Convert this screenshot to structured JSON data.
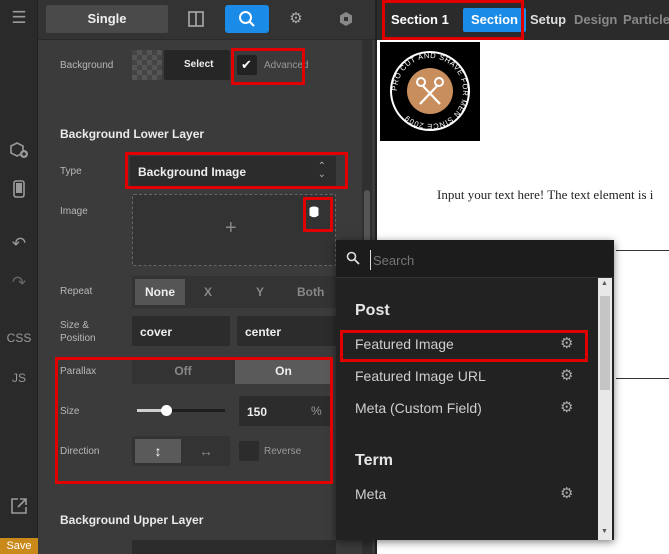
{
  "rail": {
    "css_label": "CSS",
    "js_label": "JS",
    "save_label": "Save"
  },
  "panel": {
    "mode_label": "Single",
    "background_label": "Background",
    "select_label": "Select",
    "advanced_label": "Advanced",
    "lower_layer_title": "Background Lower Layer",
    "type_label": "Type",
    "type_value": "Background Image",
    "image_label": "Image",
    "repeat_label": "Repeat",
    "repeat_options": [
      "None",
      "X",
      "Y",
      "Both"
    ],
    "size_position_label_1": "Size &",
    "size_position_label_2": "Position",
    "size_value": "cover",
    "position_value": "center",
    "parallax_label": "Parallax",
    "parallax_off": "Off",
    "parallax_on": "On",
    "size_label": "Size",
    "size_number": "150",
    "size_unit": "%",
    "slider_fraction": 0.33,
    "direction_label": "Direction",
    "reverse_label": "Reverse",
    "upper_layer_title": "Background Upper Layer"
  },
  "canvas": {
    "crumbs": [
      "Section 1",
      "Section",
      "Setup",
      "Design",
      "Particles"
    ],
    "logo_text": "PRO CUT AND SHAVE FOR MEN SINCE 2009",
    "body_text": "Input your text here! The text element is i"
  },
  "dropdown": {
    "search_placeholder": "Search",
    "groups": [
      {
        "title": "Post",
        "items": [
          "Featured Image",
          "Featured Image URL",
          "Meta (Custom Field)"
        ]
      },
      {
        "title": "Term",
        "items": [
          "Meta"
        ]
      }
    ]
  },
  "colors": {
    "accent": "#1a8be6",
    "highlight": "#e00000",
    "save": "#c98a1b"
  }
}
